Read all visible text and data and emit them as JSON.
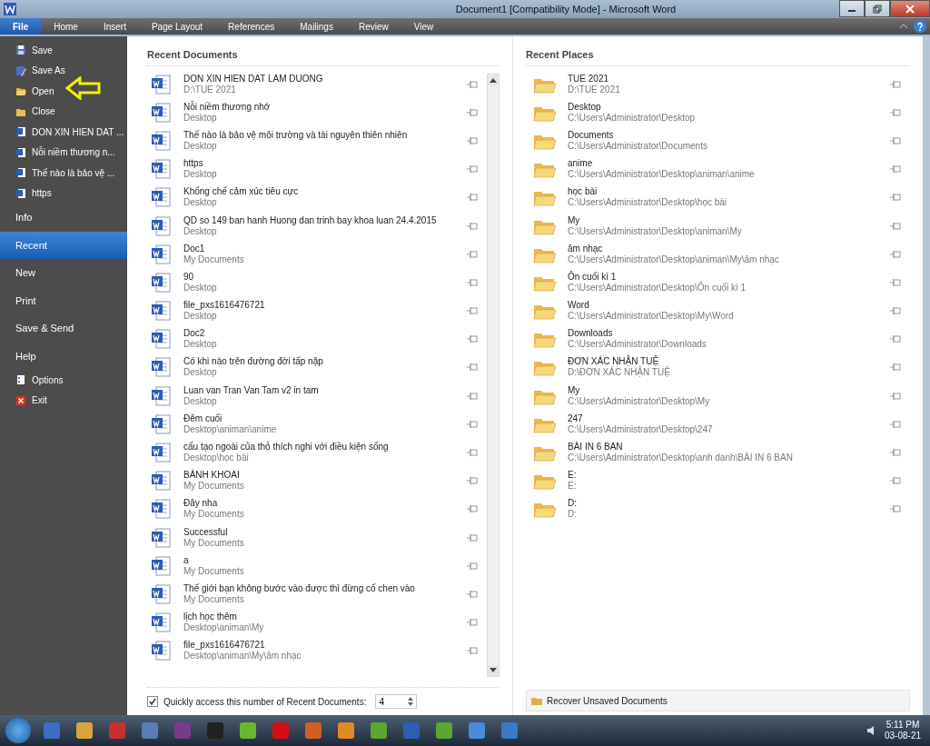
{
  "window": {
    "title": "Document1 [Compatibility Mode]  -  Microsoft Word"
  },
  "ribbon_tabs": [
    {
      "label": "File",
      "selected": true
    },
    {
      "label": "Home",
      "selected": false
    },
    {
      "label": "Insert",
      "selected": false
    },
    {
      "label": "Page Layout",
      "selected": false
    },
    {
      "label": "References",
      "selected": false
    },
    {
      "label": "Mailings",
      "selected": false
    },
    {
      "label": "Review",
      "selected": false
    },
    {
      "label": "View",
      "selected": false
    }
  ],
  "sidebar": {
    "items": [
      {
        "kind": "command",
        "label": "Save",
        "selected": false
      },
      {
        "kind": "command",
        "label": "Save As",
        "selected": false
      },
      {
        "kind": "command",
        "label": "Open",
        "selected": false
      },
      {
        "kind": "command",
        "label": "Close",
        "selected": false
      },
      {
        "kind": "recent",
        "label": "DON XIN HIEN DAT ...",
        "selected": false
      },
      {
        "kind": "recent",
        "label": "Nỗi niềm thương n...",
        "selected": false
      },
      {
        "kind": "recent",
        "label": "Thế nào là bảo vệ ...",
        "selected": false
      },
      {
        "kind": "recent",
        "label": "https",
        "selected": false
      },
      {
        "kind": "section",
        "label": "Info",
        "selected": false
      },
      {
        "kind": "section",
        "label": "Recent",
        "selected": true
      },
      {
        "kind": "section",
        "label": "New",
        "selected": false
      },
      {
        "kind": "section",
        "label": "Print",
        "selected": false
      },
      {
        "kind": "section",
        "label": "Save & Send",
        "selected": false
      },
      {
        "kind": "section",
        "label": "Help",
        "selected": false
      },
      {
        "kind": "command",
        "label": "Options",
        "selected": false
      },
      {
        "kind": "command",
        "label": "Exit",
        "selected": false
      }
    ]
  },
  "recent_documents": {
    "title": "Recent Documents",
    "items": [
      {
        "name": "DON XIN HIEN DAT LAM DUONG",
        "path": "D:\\TUE 2021"
      },
      {
        "name": "Nỗi niềm thương nhớ",
        "path": "Desktop"
      },
      {
        "name": "Thế nào là bảo vệ môi trường và tài nguyên thiên nhiên",
        "path": "Desktop"
      },
      {
        "name": "https",
        "path": "Desktop"
      },
      {
        "name": "Khống chế cảm xúc tiêu cực",
        "path": "Desktop"
      },
      {
        "name": "QD so 149 ban hanh Huong dan trinh bay khoa luan 24.4.2015",
        "path": "Desktop"
      },
      {
        "name": "Doc1",
        "path": "My Documents"
      },
      {
        "name": "90",
        "path": "Desktop"
      },
      {
        "name": "file_pxs1616476721",
        "path": "Desktop"
      },
      {
        "name": "Doc2",
        "path": "Desktop"
      },
      {
        "name": "Có khi nào trên đường đời tấp nập",
        "path": "Desktop"
      },
      {
        "name": "Luan van Tran Van Tam v2 in tam",
        "path": "Desktop"
      },
      {
        "name": "Đêm cuối",
        "path": "Desktop\\animan\\anime"
      },
      {
        "name": "cấu tạo ngoài của thỏ thích nghi với điều kiện sống",
        "path": "Desktop\\học bài"
      },
      {
        "name": "BÁNH KHOAI",
        "path": "My Documents"
      },
      {
        "name": "Đây nha",
        "path": "My Documents"
      },
      {
        "name": "Successful",
        "path": "My Documents"
      },
      {
        "name": "a",
        "path": "My Documents"
      },
      {
        "name": "Thế giới bạn không bước vào được thì đừng cố chen vào",
        "path": "My Documents"
      },
      {
        "name": "lịch học thêm",
        "path": "Desktop\\animan\\My"
      },
      {
        "name": "file_pxs1616476721",
        "path": "Desktop\\animan\\My\\âm nhạc"
      }
    ],
    "quick_access": {
      "label": "Quickly access this number of Recent Documents:",
      "checked": true,
      "value": "4"
    }
  },
  "recent_places": {
    "title": "Recent Places",
    "items": [
      {
        "name": "TUE 2021",
        "path": "D:\\TUE 2021"
      },
      {
        "name": "Desktop",
        "path": "C:\\Users\\Administrator\\Desktop"
      },
      {
        "name": "Documents",
        "path": "C:\\Users\\Administrator\\Documents"
      },
      {
        "name": "anime",
        "path": "C:\\Users\\Administrator\\Desktop\\animan\\anime"
      },
      {
        "name": "học bài",
        "path": "C:\\Users\\Administrator\\Desktop\\học bài"
      },
      {
        "name": "My",
        "path": "C:\\Users\\Administrator\\Desktop\\animan\\My"
      },
      {
        "name": "âm nhạc",
        "path": "C:\\Users\\Administrator\\Desktop\\animan\\My\\âm nhạc"
      },
      {
        "name": "Ôn cuối kì 1",
        "path": "C:\\Users\\Administrator\\Desktop\\Ôn cuối kì 1"
      },
      {
        "name": "Word",
        "path": "C:\\Users\\Administrator\\Desktop\\My\\Word"
      },
      {
        "name": "Downloads",
        "path": "C:\\Users\\Administrator\\Downloads"
      },
      {
        "name": "ĐƠN XÁC NHẬN TUỆ",
        "path": "D:\\ĐƠN XÁC NHẬN TUỆ"
      },
      {
        "name": "My",
        "path": "C:\\Users\\Administrator\\Desktop\\My"
      },
      {
        "name": "247",
        "path": "C:\\Users\\Administrator\\Desktop\\247"
      },
      {
        "name": "BÀI IN 6 BAN",
        "path": "C:\\Users\\Administrator\\Desktop\\anh danh\\BÀI IN 6 BAN"
      },
      {
        "name": "E:",
        "path": "E:"
      },
      {
        "name": "D:",
        "path": "D:"
      }
    ],
    "recover_button": "Recover Unsaved Documents"
  },
  "taskbar": {
    "apps": [
      {
        "color": "#3a6fc4"
      },
      {
        "color": "#d8a640"
      },
      {
        "color": "#c83030"
      },
      {
        "color": "#5a7ab8"
      },
      {
        "color": "#7a3a8a"
      },
      {
        "color": "#222222"
      },
      {
        "color": "#6ab630"
      },
      {
        "color": "#d01010"
      },
      {
        "color": "#d06020"
      },
      {
        "color": "#e08a20"
      },
      {
        "color": "#5aa830"
      },
      {
        "color": "#2b5fb4"
      },
      {
        "color": "#5aa830"
      },
      {
        "color": "#4a8ad8"
      },
      {
        "color": "#3a7ac8"
      }
    ],
    "time": "5:11 PM",
    "date": "03-08-21"
  }
}
